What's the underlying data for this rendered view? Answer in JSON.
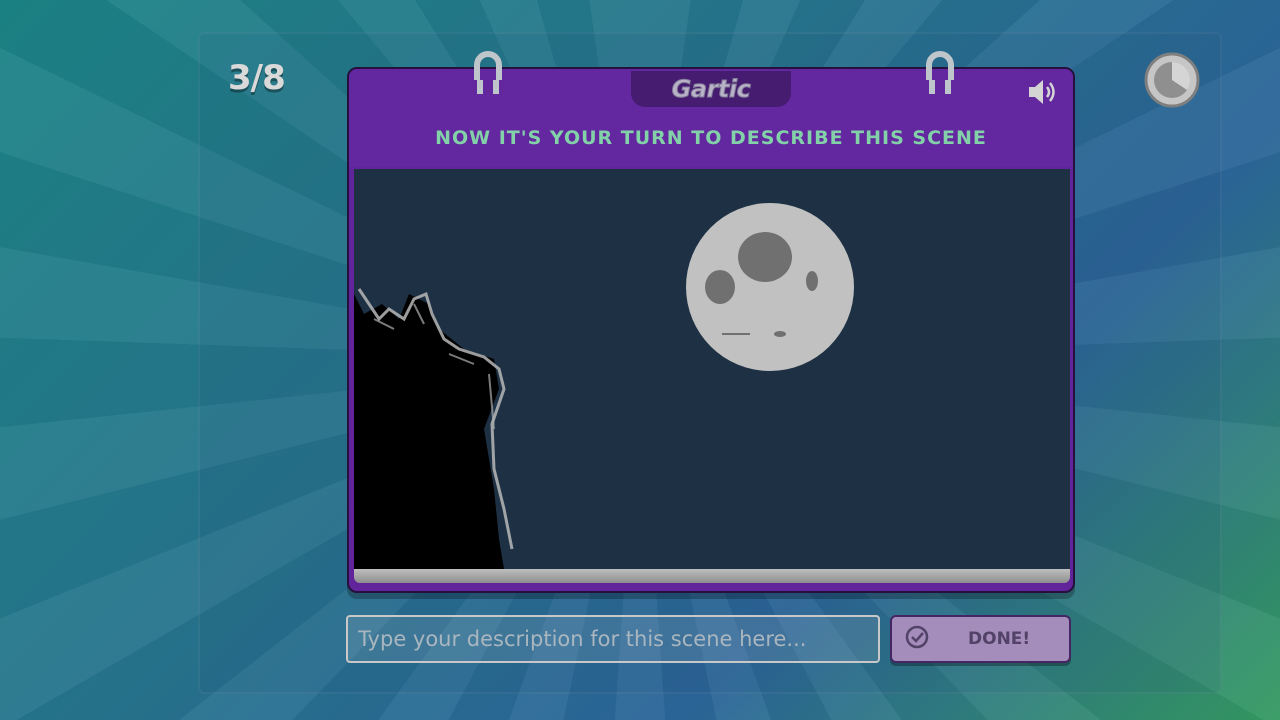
{
  "round": {
    "counter": "3/8"
  },
  "book": {
    "brand": "Gartic",
    "instruction": "NOW IT'S YOUR TURN TO DESCRIBE THIS SCENE"
  },
  "icons": {
    "timer": "timer-icon",
    "sound": "speaker-icon",
    "done": "check-icon"
  },
  "input": {
    "placeholder": "Type your description for this scene here...",
    "value": ""
  },
  "done_button": {
    "label": "DONE!"
  },
  "colors": {
    "book_purple": "#6c2cae",
    "instruction_green": "#8fe3b7",
    "canvas_bg": "#21364a",
    "button_bg": "#b29acb"
  }
}
